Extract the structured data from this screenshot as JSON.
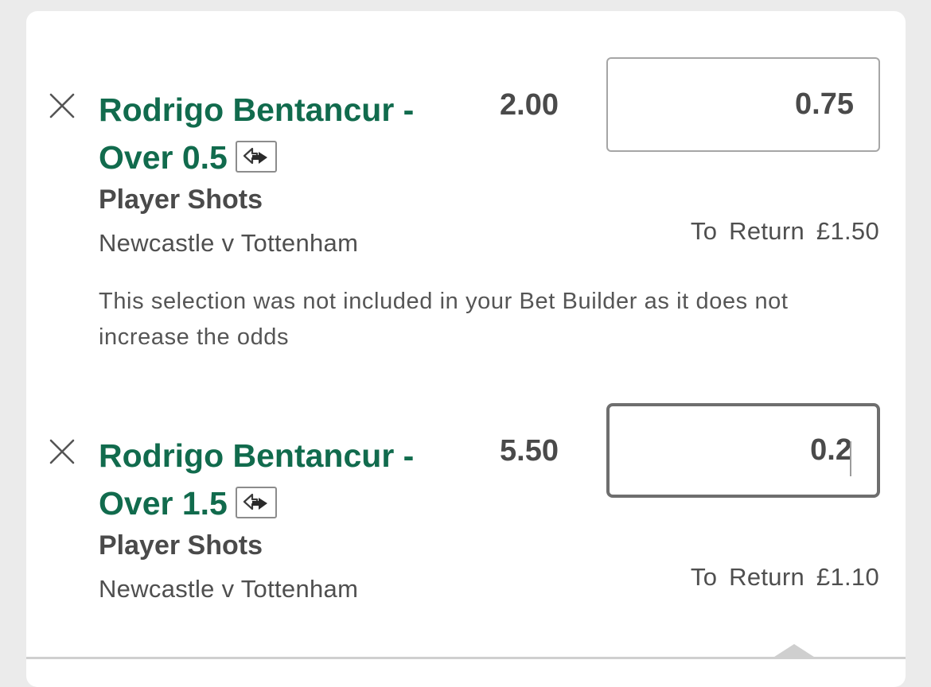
{
  "bets": [
    {
      "selection": "Rodrigo Bentancur - Over 0.5",
      "selection_line1": "Rodrigo Bentancur -",
      "selection_line2": "Over 0.5",
      "odds": "2.00",
      "stake_value": "0.75",
      "market": "Player Shots",
      "event": "Newcastle v Tottenham",
      "to_return": "To Return £1.50",
      "notice": "This selection was not included in your Bet Builder as it does not increase the odds",
      "swap_icon": "swap-arrows-icon",
      "close_icon": "close-icon"
    },
    {
      "selection": "Rodrigo Bentancur - Over 1.5",
      "selection_line1": "Rodrigo Bentancur -",
      "selection_line2": "Over 1.5",
      "odds": "5.50",
      "stake_value": "0.2",
      "market": "Player Shots",
      "event": "Newcastle v Tottenham",
      "to_return": "To Return £1.10",
      "swap_icon": "swap-arrows-icon",
      "close_icon": "close-icon"
    }
  ],
  "colors": {
    "selection_green": "#116b4d",
    "text_dark": "#4a4a4a",
    "background": "#ebebeb",
    "card": "#ffffff"
  }
}
